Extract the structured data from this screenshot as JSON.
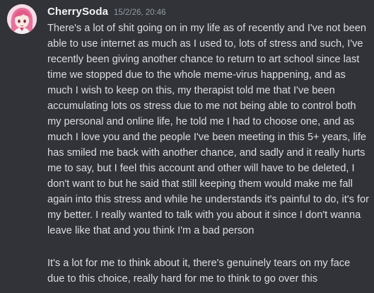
{
  "message": {
    "author": "CherrySoda",
    "timestamp": "15/2/26, 20:46",
    "paragraphs": [
      "There's a lot of shit going on in my life as of recently and I've not been able to use internet as much as I used to, lots of stress and such, I've recently been giving another chance to return to art school since last time we stopped due to the whole meme-virus happening, and as much I wish to keep on this, my therapist told me that I've been accumulating lots os stress due to me not being able to control both my personal and online life, he told me I had to choose one, and as much I love you and the people I've been meeting in this 5+ years, life has smiled me back with another chance, and sadly and it really hurts me to say, but I feel this account and other will have to be deleted, I don't want to but he said that still keeping them would make me fall again into this stress and while he understands it's painful to do, it's for my better. I really wanted to talk with you about it since I don't wanna leave like that and you think I'm a bad person",
      "It's a lot for me to think about it, there's genuinely tears on my face due to this choice, really hard for me to think to go over this"
    ]
  },
  "colors": {
    "background": "#313338",
    "username": "#f2f3f5",
    "timestamp": "#949ba4",
    "text": "#dbdee1",
    "avatar_hair": "#e8739a"
  }
}
